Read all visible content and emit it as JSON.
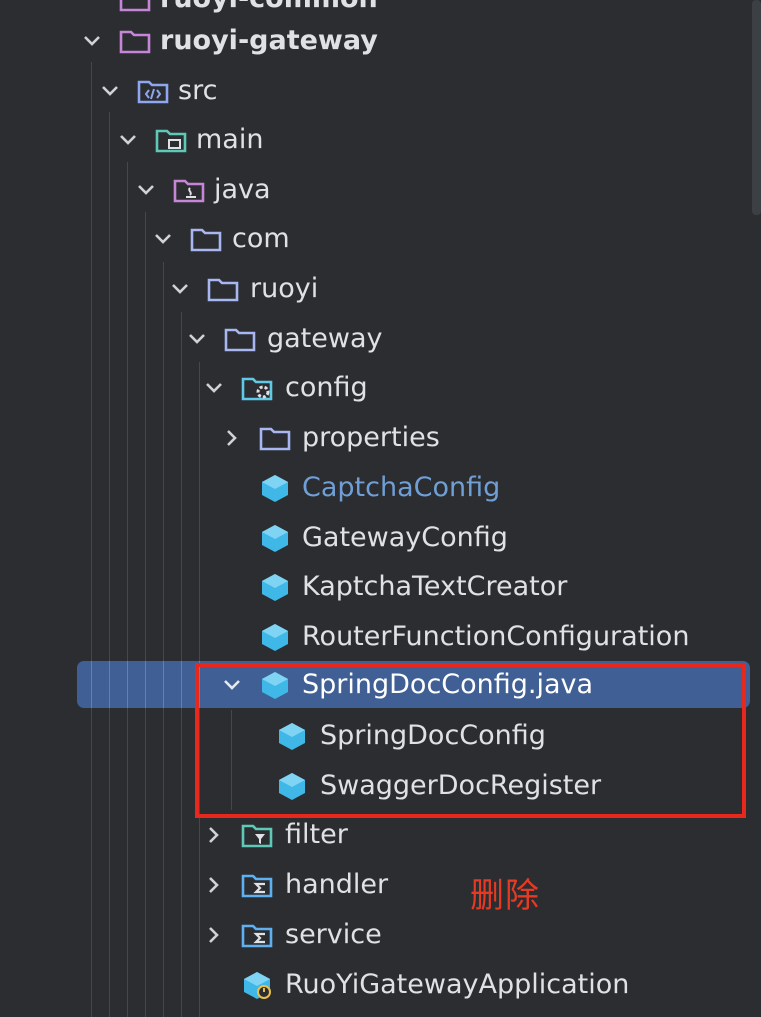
{
  "tree": {
    "items": [
      {
        "label": "ruoyi-common",
        "icon": "module-folder-icon",
        "expanded": false,
        "bold": true
      },
      {
        "label": "ruoyi-gateway",
        "icon": "module-folder-icon",
        "expanded": true,
        "bold": true
      },
      {
        "label": "src",
        "icon": "source-folder-icon",
        "expanded": true
      },
      {
        "label": "main",
        "icon": "main-folder-icon",
        "expanded": true
      },
      {
        "label": "java",
        "icon": "java-source-root-icon",
        "expanded": true
      },
      {
        "label": "com",
        "icon": "package-folder-icon",
        "expanded": true
      },
      {
        "label": "ruoyi",
        "icon": "package-folder-icon",
        "expanded": true
      },
      {
        "label": "gateway",
        "icon": "package-folder-icon",
        "expanded": true
      },
      {
        "label": "config",
        "icon": "config-folder-icon",
        "expanded": true
      },
      {
        "label": "properties",
        "icon": "package-folder-icon",
        "expanded": false
      },
      {
        "label": "CaptchaConfig",
        "icon": "java-class-icon",
        "modified": true
      },
      {
        "label": "GatewayConfig",
        "icon": "java-class-icon"
      },
      {
        "label": "KaptchaTextCreator",
        "icon": "java-class-icon"
      },
      {
        "label": "RouterFunctionConfiguration",
        "icon": "java-class-icon"
      },
      {
        "label": "SpringDocConfig.java",
        "icon": "java-class-icon",
        "expanded": true,
        "selected": true
      },
      {
        "label": "SpringDocConfig",
        "icon": "java-class-icon"
      },
      {
        "label": "SwaggerDocRegister",
        "icon": "java-class-icon"
      },
      {
        "label": "filter",
        "icon": "filter-folder-icon",
        "expanded": false
      },
      {
        "label": "handler",
        "icon": "handler-folder-icon",
        "expanded": false
      },
      {
        "label": "service",
        "icon": "service-folder-icon",
        "expanded": false
      },
      {
        "label": "RuoYiGatewayApplication",
        "icon": "spring-boot-app-icon"
      }
    ]
  },
  "annotation": {
    "text": "删除",
    "color": "#e53a24"
  },
  "colors": {
    "background": "#2b2d30",
    "selection": "#3f5f95",
    "highlight_box": "#e8281c",
    "folder_stroke": "#a8b6f2",
    "class_icon": "#3fb8e8",
    "modified_text": "#6f9fd6"
  }
}
